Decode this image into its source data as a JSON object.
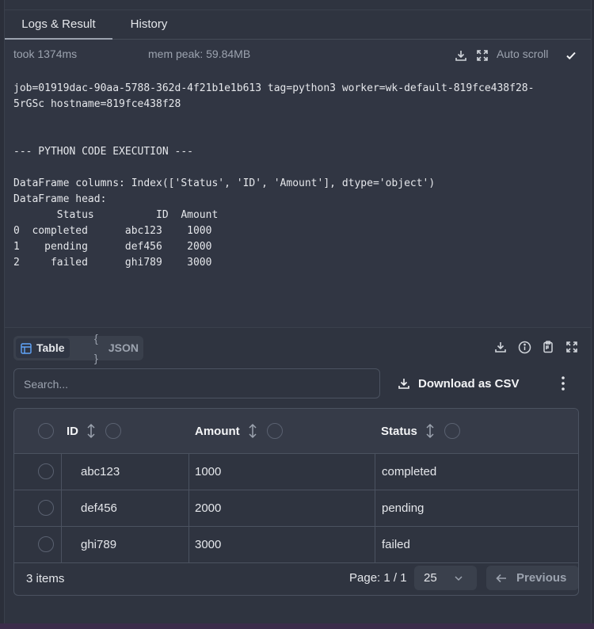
{
  "tabs": [
    {
      "label": "Logs & Result"
    },
    {
      "label": "History"
    }
  ],
  "logs": {
    "took": "took 1374ms",
    "mem_peak": "mem peak: 59.84MB",
    "auto_scroll": "Auto scroll",
    "lines": [
      "job=01919dac-90aa-5788-362d-4f21b1e1b613 tag=python3 worker=wk-default-819fce438f28-",
      "5rGSc hostname=819fce438f28",
      "",
      "",
      "--- PYTHON CODE EXECUTION ---",
      "",
      "DataFrame columns: Index(['Status', 'ID', 'Amount'], dtype='object')",
      "DataFrame head:",
      "       Status          ID  Amount",
      "0  completed      abc123    1000",
      "1    pending      def456    2000",
      "2     failed      ghi789    3000"
    ]
  },
  "result": {
    "view_tabs": [
      {
        "label": "Table"
      },
      {
        "label": "JSON",
        "icon": "{ }"
      }
    ],
    "search_placeholder": "Search...",
    "download_csv": "Download as CSV",
    "columns": [
      "ID",
      "Amount",
      "Status"
    ],
    "rows": [
      {
        "id": "abc123",
        "amount": "1000",
        "status": "completed"
      },
      {
        "id": "def456",
        "amount": "2000",
        "status": "pending"
      },
      {
        "id": "ghi789",
        "amount": "3000",
        "status": "failed"
      }
    ],
    "items_count": "3 items",
    "page": "Page: 1 / 1",
    "page_size": "25",
    "previous": "Previous"
  },
  "colors": {
    "background": "#2f3440",
    "border": "#4b5260",
    "text": "#e5e7eb",
    "muted": "#9ca3af"
  }
}
